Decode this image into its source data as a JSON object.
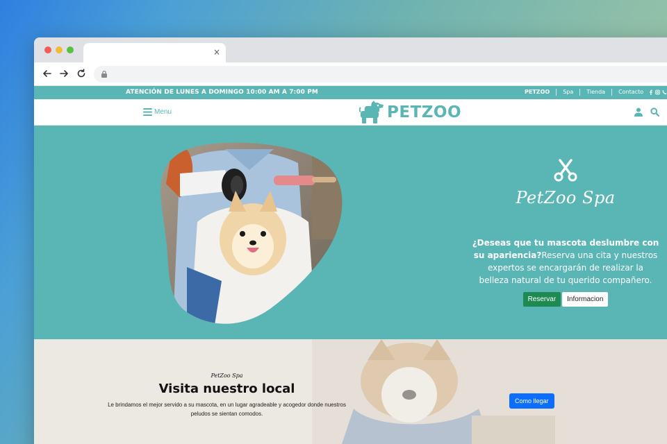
{
  "browser": {
    "tab_close": "×"
  },
  "topbar": {
    "hours": "ATENCIÓN DE LUNES A DOMINGO 10:00 AM A 7:00 PM",
    "links": [
      "PETZOO",
      "Spa",
      "Tienda",
      "Contacto"
    ]
  },
  "header": {
    "menu_label": "Menu",
    "logo_text": "PETZOO"
  },
  "hero": {
    "title": "PetZoo Spa",
    "question": "¿Deseas que tu mascota deslumbre con su apariencia?",
    "text": "Reserva una cita y nuestros expertos se encargarán de realizar la belleza natural de tu querido compañero.",
    "reservar_label": "Reservar",
    "informacion_label": "Informacion"
  },
  "visit": {
    "subtitle": "PetZoo Spa",
    "title": "Visita nuestro local",
    "description": "Le brindamos el mejor servido a su mascota, en un lugar agradeable y acogedor donde nuestros peludos se sientan comodos.",
    "button_label": "Como llegar"
  },
  "colors": {
    "brand_teal": "#5ab5b5",
    "reservar_green": "#1e8a51",
    "como_llegar_blue": "#0d6efd"
  },
  "icons": [
    "back-arrow-icon",
    "forward-arrow-icon",
    "reload-icon",
    "lock-icon",
    "facebook-icon",
    "instagram-icon",
    "phone-icon",
    "menu-icon",
    "dog-logo-icon",
    "user-icon",
    "search-icon",
    "scissors-icon"
  ]
}
